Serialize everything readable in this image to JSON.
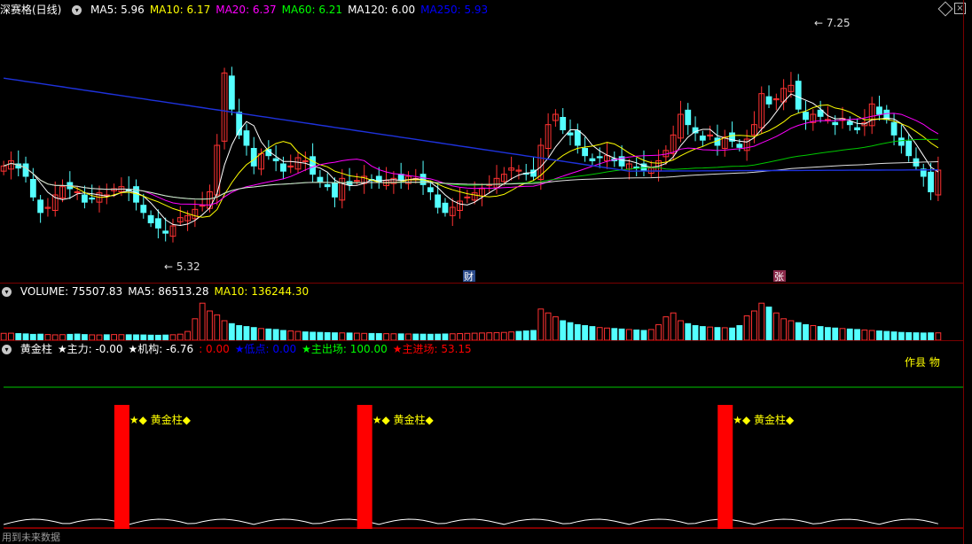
{
  "header": {
    "title": "深赛格(日线)",
    "ma": [
      {
        "label": "MA5: 5.96",
        "color": "#ffffff"
      },
      {
        "label": "MA10: 6.17",
        "color": "#ffff00"
      },
      {
        "label": "MA20: 6.37",
        "color": "#ff00ff"
      },
      {
        "label": "MA60: 6.21",
        "color": "#00ff00"
      },
      {
        "label": "MA120: 6.00",
        "color": "#ffffff"
      },
      {
        "label": "MA250: 5.93",
        "color": "#0000ff"
      }
    ]
  },
  "volume_header": {
    "items": [
      {
        "label": "VOLUME: 75507.83",
        "color": "#ffffff"
      },
      {
        "label": "MA5: 86513.28",
        "color": "#ffffff"
      },
      {
        "label": "MA10: 136244.30",
        "color": "#ffff00"
      }
    ]
  },
  "indicator_header": {
    "items": [
      {
        "label": "黄金柱",
        "color": "#ffffff"
      },
      {
        "label": "★主力: -0.00",
        "color": "#ffffff"
      },
      {
        "label": "★机构: -6.76",
        "color": "#ffffff"
      },
      {
        "label": ": 0.00",
        "color": "#ff0000"
      },
      {
        "label": "★低点: 0.00",
        "color": "#0000ff"
      },
      {
        "label": "★主出场: 100.00",
        "color": "#00ff00"
      },
      {
        "label": "★主进场: 53.15",
        "color": "#ff0000"
      }
    ],
    "right_text": "作县 物"
  },
  "markers": {
    "high": "7.25",
    "low": "5.32",
    "cai": "财",
    "zhang": "张"
  },
  "golden_label": "★◆ 黄金柱◆",
  "golden_label_cut": "★◆ 黄",
  "footer": "用到未来数据",
  "colors": {
    "up": "#ff3232",
    "down": "#54ffff",
    "ma250": "#1e32dc",
    "ma20": "#ff00ff",
    "ma60": "#00c800"
  },
  "chart_data": [
    {
      "type": "candlestick",
      "title": "深赛格(日线)",
      "n_bars": 128,
      "ylim": [
        5.0,
        7.4
      ],
      "annotations": {
        "max_high": 7.25,
        "min_low": 5.32
      },
      "close": [
        6.0,
        6.05,
        5.98,
        5.9,
        5.7,
        5.55,
        5.6,
        5.72,
        5.8,
        5.78,
        5.75,
        5.65,
        5.68,
        5.74,
        5.72,
        5.78,
        5.8,
        5.76,
        5.65,
        5.55,
        5.45,
        5.4,
        5.35,
        5.42,
        5.5,
        5.52,
        5.58,
        5.62,
        5.75,
        6.2,
        6.9,
        6.55,
        6.3,
        6.2,
        6.0,
        6.12,
        6.1,
        6.05,
        5.95,
        6.0,
        6.08,
        6.05,
        5.92,
        5.85,
        5.8,
        5.7,
        5.88,
        5.82,
        5.86,
        5.9,
        5.86,
        5.84,
        5.86,
        5.88,
        5.86,
        5.9,
        5.88,
        5.82,
        5.75,
        5.6,
        5.55,
        5.6,
        5.66,
        5.7,
        5.74,
        5.78,
        5.82,
        5.88,
        5.92,
        5.98,
        5.96,
        5.92,
        5.9,
        6.2,
        6.4,
        6.5,
        6.35,
        6.3,
        6.2,
        6.1,
        6.05,
        6.08,
        6.1,
        6.05,
        6.0,
        6.02,
        5.98,
        5.96,
        5.98,
        6.05,
        6.15,
        6.3,
        6.5,
        6.4,
        6.32,
        6.25,
        6.3,
        6.2,
        6.28,
        6.24,
        6.18,
        6.26,
        6.4,
        6.7,
        6.6,
        6.65,
        6.75,
        6.78,
        6.55,
        6.45,
        6.5,
        6.48,
        6.45,
        6.4,
        6.46,
        6.4,
        6.35,
        6.42,
        6.6,
        6.5,
        6.45,
        6.3,
        6.2,
        6.1,
        6.0,
        5.9,
        5.75,
        5.96
      ]
    },
    {
      "type": "bar",
      "title": "VOLUME",
      "values": [
        70507,
        72000,
        68000,
        65000,
        60000,
        62000,
        58000,
        55000,
        57000,
        60000,
        63000,
        58000,
        55000,
        54000,
        56000,
        58000,
        57000,
        56000,
        55000,
        54000,
        52000,
        51000,
        53000,
        56000,
        62000,
        90000,
        220000,
        380000,
        300000,
        260000,
        200000,
        170000,
        150000,
        140000,
        130000,
        120000,
        115000,
        110000,
        100000,
        95000,
        90000,
        85000,
        82000,
        80000,
        78000,
        76000,
        75000,
        74000,
        72000,
        70000,
        69000,
        68000,
        67000,
        66000,
        65000,
        64000,
        63000,
        62000,
        61000,
        62000,
        64000,
        66000,
        68000,
        70000,
        72000,
        74000,
        76000,
        78000,
        80000,
        85000,
        90000,
        95000,
        100000,
        320000,
        280000,
        240000,
        200000,
        180000,
        160000,
        150000,
        140000,
        130000,
        125000,
        120000,
        115000,
        110000,
        105000,
        100000,
        110000,
        160000,
        240000,
        280000,
        200000,
        170000,
        150000,
        140000,
        135000,
        130000,
        128000,
        125000,
        150000,
        250000,
        300000,
        380000,
        340000,
        280000,
        220000,
        200000,
        180000,
        160000,
        150000,
        140000,
        130000,
        125000,
        120000,
        115000,
        110000,
        105000,
        100000,
        95000,
        90000,
        85000,
        80000,
        78000,
        76000,
        74000,
        75508,
        75508
      ]
    },
    {
      "type": "bar",
      "title": "黄金柱",
      "columns": [
        {
          "bar_index": 16
        },
        {
          "bar_index": 49
        },
        {
          "bar_index": 98
        }
      ]
    }
  ]
}
